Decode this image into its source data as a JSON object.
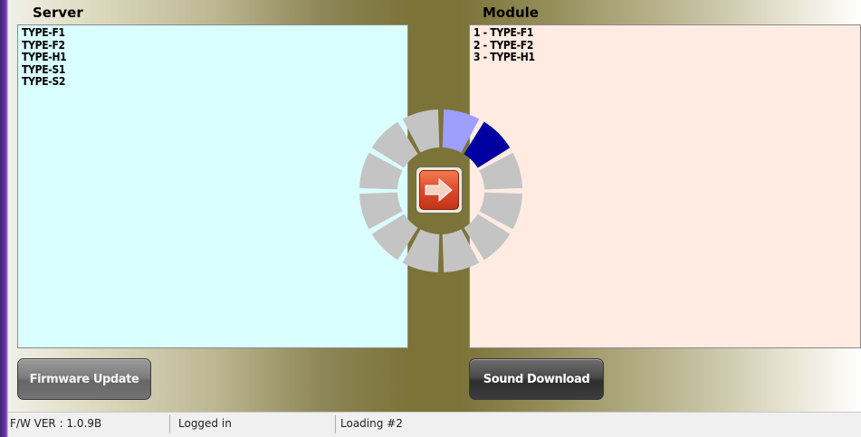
{
  "colors": {
    "server_list_bg": "#d9ffff",
    "module_list_bg": "#ffebe2",
    "spinner_idle": "#c4c4c4",
    "spinner_trail": "#9e9efc",
    "spinner_active": "#0000a0",
    "transfer_button": "#dc4a2a"
  },
  "server": {
    "title": "Server",
    "items": [
      "TYPE-F1",
      "TYPE-F2",
      "TYPE-H1",
      "TYPE-S1",
      "TYPE-S2"
    ]
  },
  "module": {
    "title": "Module",
    "items": [
      "1 - TYPE-F1",
      "2 - TYPE-F2",
      "3 - TYPE-H1"
    ]
  },
  "transfer": {
    "icon": "arrow-right-icon"
  },
  "spinner": {
    "segments": 12,
    "active_segment": 1,
    "trail_segment": 0,
    "icon": "loading-spinner-icon"
  },
  "buttons": {
    "firmware_update": "Firmware Update",
    "sound_download": "Sound Download"
  },
  "status": {
    "fw_version": "F/W VER : 1.0.9B",
    "login": "Logged in",
    "loading": "Loading #2"
  }
}
